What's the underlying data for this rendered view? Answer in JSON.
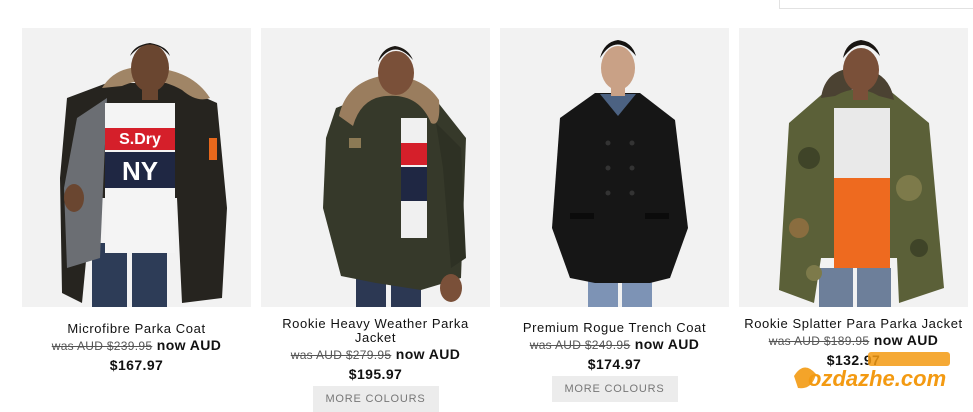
{
  "products": [
    {
      "title": "Microfibre Parka Coat",
      "was": "was AUD $239.95",
      "now_label": "now AUD",
      "price": "$167.97",
      "more": "",
      "colors": {
        "bg": "#f2f2f2",
        "coat": "#26241f",
        "lining": "#6b6e73",
        "shirt": "#f4f4f4",
        "fur": "#a08566",
        "skin": "#6a4630",
        "hair": "#1a1613",
        "jeans": "#2d3c57"
      }
    },
    {
      "title": "Rookie Heavy Weather Parka Jacket",
      "was": "was AUD $279.95",
      "now_label": "now AUD",
      "price": "$195.97",
      "more": "MORE COLOURS",
      "colors": {
        "bg": "#f2f2f2",
        "coat": "#36392a",
        "lining": "#2a2c22",
        "shirt": "#f0f0f0",
        "fur": "#9a7d5e",
        "skin": "#7a5039",
        "hair": "#1c1814",
        "jeans": "#2c3853"
      }
    },
    {
      "title": "Premium Rogue Trench Coat",
      "was": "was AUD $249.95",
      "now_label": "now AUD",
      "price": "$174.97",
      "more": "MORE COLOURS",
      "colors": {
        "bg": "#f2f2f2",
        "coat": "#161616",
        "lining": "#161616",
        "shirt": "#4c6282",
        "fur": "#161616",
        "skin": "#c9a186",
        "hair": "#141210",
        "jeans": "#7d93b5"
      }
    },
    {
      "title": "Rookie Splatter Para Parka Jacket",
      "was": "was AUD $189.95",
      "now_label": "now AUD",
      "price": "$132.97",
      "more": "",
      "colors": {
        "bg": "#f2f2f2",
        "coat": "#5b6038",
        "lining": "#3f3a2c",
        "shirt": "#ee6a1f",
        "fur": "#4b4232",
        "skin": "#7a5039",
        "hair": "#1a1613",
        "jeans": "#6d7f9a"
      }
    }
  ],
  "tees": [
    "S.Dry",
    "NY"
  ],
  "watermark": {
    "text": "ozdazhe.com",
    "color_primary": "#f39a12",
    "color_secondary": "#1d4fa3"
  }
}
